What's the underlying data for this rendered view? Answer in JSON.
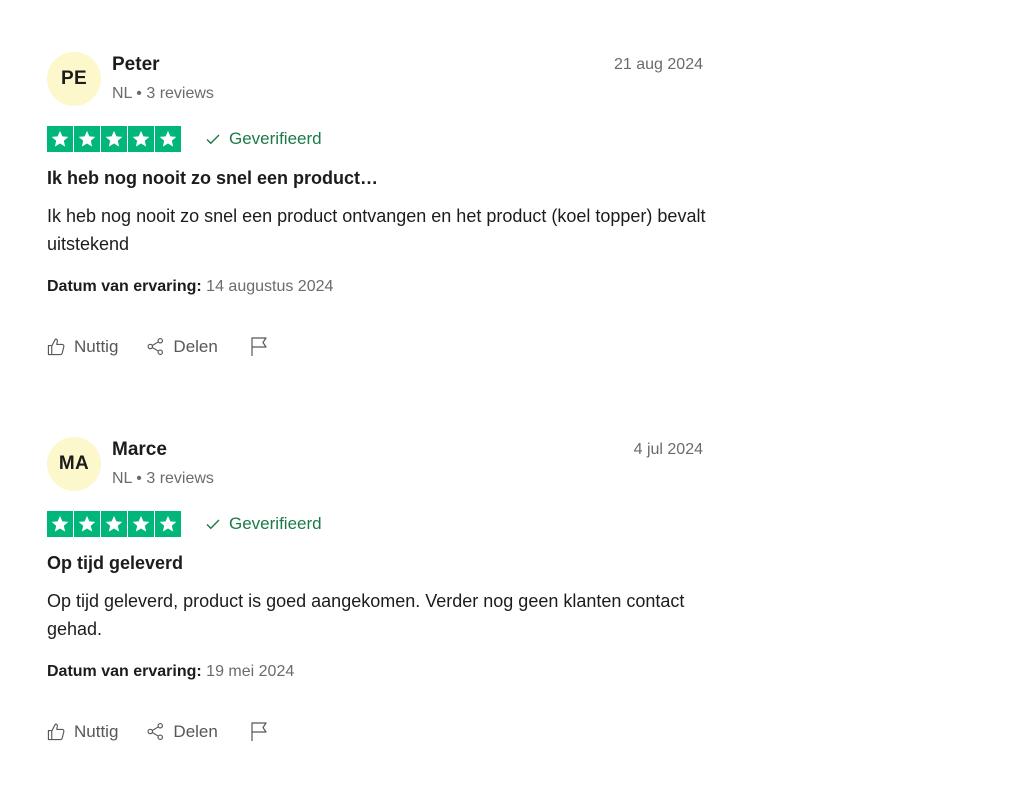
{
  "reviews": [
    {
      "initials": "PE",
      "name": "Peter",
      "meta": "NL • 3 reviews",
      "date": "21 aug 2024",
      "rating": 5,
      "verified_label": "Geverifieerd",
      "title": "Ik heb nog nooit zo snel een product…",
      "body": "Ik heb nog nooit zo snel een product ontvangen en het product (koel topper) bevalt uitstekend",
      "experience_label": "Datum van ervaring:",
      "experience_value": "14 augustus 2024",
      "helpful_label": "Nuttig",
      "share_label": "Delen"
    },
    {
      "initials": "MA",
      "name": "Marce",
      "meta": "NL • 3 reviews",
      "date": "4 jul 2024",
      "rating": 5,
      "verified_label": "Geverifieerd",
      "title": "Op tijd geleverd",
      "body": "Op tijd geleverd, product is goed aangekomen. Verder nog geen klanten contact gehad.",
      "experience_label": "Datum van ervaring:",
      "experience_value": "19 mei 2024",
      "helpful_label": "Nuttig",
      "share_label": "Delen"
    }
  ],
  "colors": {
    "star_green": "#00b67a",
    "verified_green": "#1d7a48",
    "avatar_bg": "#fcf8cc",
    "muted_text": "#6b6b6b"
  },
  "icons": {
    "star": "star-icon",
    "verified": "check-icon",
    "helpful": "thumbs-up-icon",
    "share": "share-icon",
    "report": "flag-icon"
  }
}
